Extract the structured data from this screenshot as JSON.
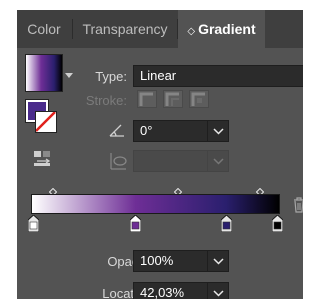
{
  "tabs": [
    {
      "label": "Color"
    },
    {
      "label": "Transparency"
    },
    {
      "label": "Gradient",
      "icon": "updown-arrows-icon",
      "active": true
    }
  ],
  "type": {
    "label": "Type:",
    "value": "Linear"
  },
  "stroke": {
    "label": "Stroke:"
  },
  "angle": {
    "value": "0°"
  },
  "aspect_ratio": {
    "value": ""
  },
  "gradient": {
    "colors": [
      "#ffffff",
      "#6e2e96",
      "#2a1f6e",
      "#000000"
    ],
    "stops": [
      0,
      42.03,
      78.5,
      100
    ],
    "midpoints": [
      9,
      59,
      92
    ]
  },
  "opacity": {
    "label": "Opacity:",
    "value": "100%"
  },
  "location": {
    "label": "Location:",
    "value": "42,03%"
  },
  "colors": {
    "panel": "#535353",
    "tab_bar": "#3f3f3f",
    "field": "#2b2b2b"
  }
}
